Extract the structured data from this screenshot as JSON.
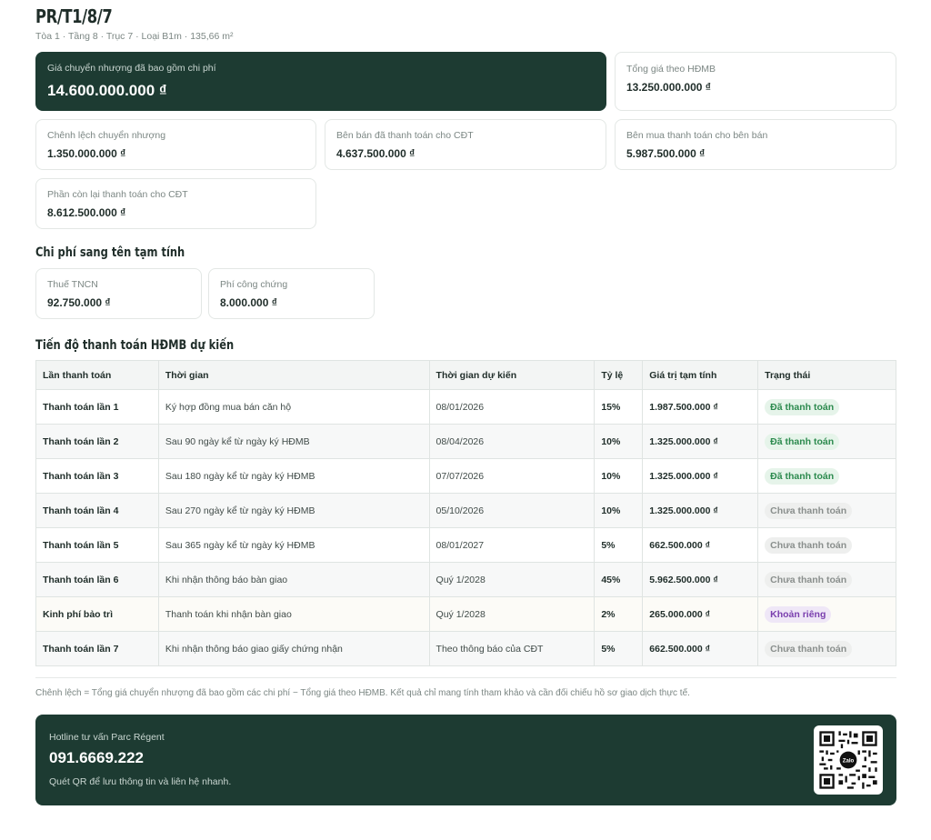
{
  "unit": {
    "code": "PR/T1/8/7",
    "subtitle": "Tòa 1 · Tầng 8 · Trục 7 · Loại B1m · 135,66 m²"
  },
  "summary": {
    "transfer_price": {
      "label": "Giá chuyển nhượng đã bao gồm chi phí",
      "value": "14.600.000.000 ₫"
    },
    "contract_total": {
      "label": "Tổng giá theo HĐMB",
      "value": "13.250.000.000 ₫"
    },
    "difference": {
      "label": "Chênh lệch chuyển nhượng",
      "value": "1.350.000.000 ₫"
    },
    "seller_paid": {
      "label": "Bên bán đã thanh toán cho CĐT",
      "value": "4.637.500.000 ₫"
    },
    "buyer_pays_seller": {
      "label": "Bên mua thanh toán cho bên bán",
      "value": "5.987.500.000 ₫"
    },
    "remaining_to_developer": {
      "label": "Phần còn lại thanh toán cho CĐT",
      "value": "8.612.500.000 ₫"
    }
  },
  "fees": {
    "title": "Chi phí sang tên tạm tính",
    "tax": {
      "label": "Thuế TNCN",
      "value": "92.750.000 ₫"
    },
    "notary": {
      "label": "Phí công chứng",
      "value": "8.000.000 ₫"
    }
  },
  "schedule": {
    "title": "Tiến độ thanh toán HĐMB dự kiến",
    "columns": [
      "Lần thanh toán",
      "Thời gian",
      "Thời gian dự kiến",
      "Tỷ lệ",
      "Giá trị tạm tính",
      "Trạng thái"
    ],
    "rows": [
      {
        "name": "Thanh toán lần 1",
        "time": "Ký hợp đồng mua bán căn hộ",
        "expected": "08/01/2026",
        "rate": "15%",
        "amount": "1.987.500.000 ₫",
        "status": "Đã thanh toán",
        "status_type": "paid"
      },
      {
        "name": "Thanh toán lần 2",
        "time": "Sau 90 ngày kể từ ngày ký HĐMB",
        "expected": "08/04/2026",
        "rate": "10%",
        "amount": "1.325.000.000 ₫",
        "status": "Đã thanh toán",
        "status_type": "paid"
      },
      {
        "name": "Thanh toán lần 3",
        "time": "Sau 180 ngày kể từ ngày ký HĐMB",
        "expected": "07/07/2026",
        "rate": "10%",
        "amount": "1.325.000.000 ₫",
        "status": "Đã thanh toán",
        "status_type": "paid"
      },
      {
        "name": "Thanh toán lần 4",
        "time": "Sau 270 ngày kể từ ngày ký HĐMB",
        "expected": "05/10/2026",
        "rate": "10%",
        "amount": "1.325.000.000 ₫",
        "status": "Chưa thanh toán",
        "status_type": "unpaid"
      },
      {
        "name": "Thanh toán lần 5",
        "time": "Sau 365 ngày kể từ ngày ký HĐMB",
        "expected": "08/01/2027",
        "rate": "5%",
        "amount": "662.500.000 ₫",
        "status": "Chưa thanh toán",
        "status_type": "unpaid"
      },
      {
        "name": "Thanh toán lần 6",
        "time": "Khi nhận thông báo bàn giao",
        "expected": "Quý 1/2028",
        "rate": "45%",
        "amount": "5.962.500.000 ₫",
        "status": "Chưa thanh toán",
        "status_type": "unpaid"
      },
      {
        "name": "Kinh phí bảo trì",
        "time": "Thanh toán khi nhận bàn giao",
        "expected": "Quý 1/2028",
        "rate": "2%",
        "amount": "265.000.000 ₫",
        "status": "Khoản riêng",
        "status_type": "special"
      },
      {
        "name": "Thanh toán lần 7",
        "time": "Khi nhận thông báo giao giấy chứng nhận",
        "expected": "Theo thông báo của CĐT",
        "rate": "5%",
        "amount": "662.500.000 ₫",
        "status": "Chưa thanh toán",
        "status_type": "unpaid"
      }
    ]
  },
  "note": "Chênh lệch = Tổng giá chuyển nhượng đã bao gồm các chi phí − Tổng giá theo HĐMB. Kết quả chỉ mang tính tham khảo và cần đối chiếu hồ sơ giao dịch thực tế.",
  "hotline": {
    "label": "Hotline tư vấn Parc Régent",
    "number": "091.6669.222",
    "note": "Quét QR để lưu thông tin và liên hệ nhanh.",
    "qr_logo_text": "Zalo"
  },
  "colors": {
    "accent_dark": "#1d3b32",
    "paid": "#2c8a4e",
    "unpaid": "#8a8f8d",
    "special": "#7a3fae"
  }
}
